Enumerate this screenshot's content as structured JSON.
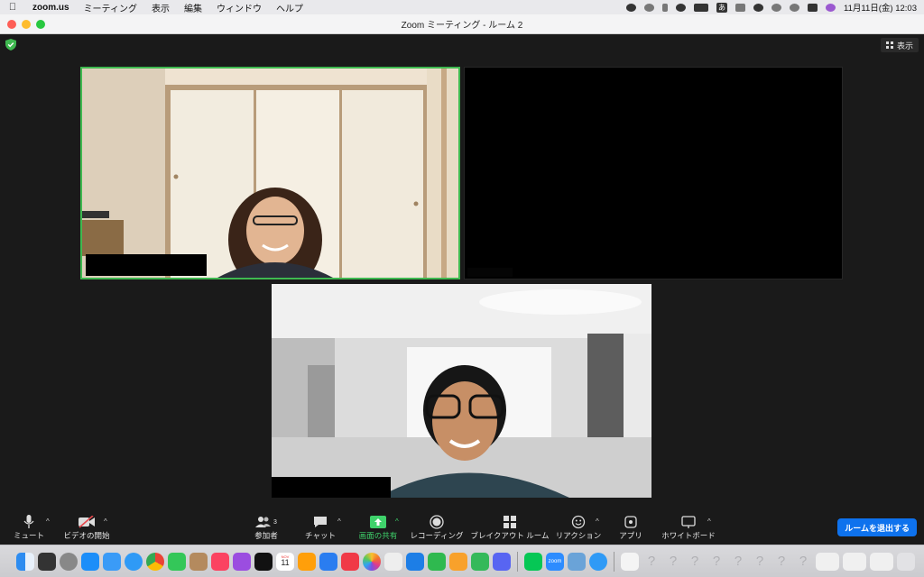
{
  "menubar": {
    "app_name": "zoom.us",
    "items": [
      "ミーティング",
      "表示",
      "編集",
      "ウィンドウ",
      "ヘルプ"
    ],
    "clock": "11月11日(金)  12:03",
    "input_mode": "あ"
  },
  "window": {
    "title": "Zoom ミーティング - ルーム 2"
  },
  "meeting": {
    "view_label": "表示",
    "active_speaker_color": "#3fb950"
  },
  "toolbar": {
    "mute_label": "ミュート",
    "video_label": "ビデオの開始",
    "participants_label": "参加者",
    "participants_count": "3",
    "chat_label": "チャット",
    "share_label": "画面の共有",
    "record_label": "レコーディング",
    "breakout_label": "ブレイクアウト ルーム",
    "reactions_label": "リアクション",
    "apps_label": "アプリ",
    "whiteboard_label": "ホワイトボード",
    "leave_label": "ルームを退出する"
  },
  "dock": {
    "calendar_day": "11",
    "calendar_month": "NOV",
    "zoom_label": "zoom"
  },
  "colors": {
    "share_green": "#3fd26b",
    "leave_blue": "#0e72ed"
  }
}
